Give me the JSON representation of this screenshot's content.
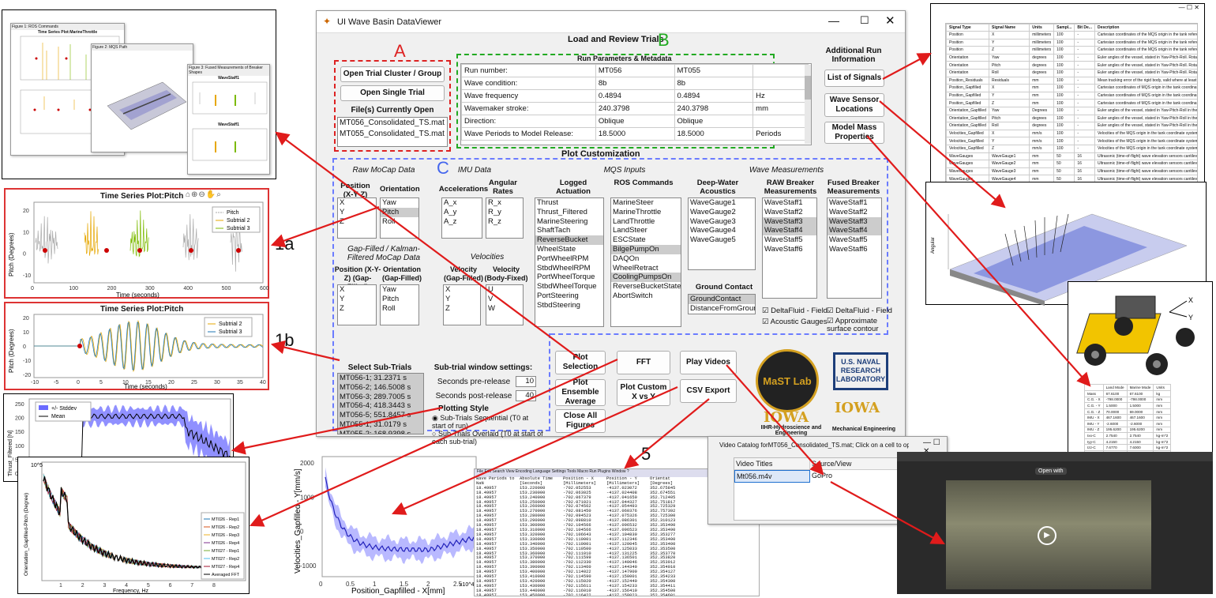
{
  "annotations": {
    "numbers": [
      "1",
      "1a",
      "1b",
      "2",
      "3",
      "4",
      "5",
      "6",
      "7",
      "8",
      "9"
    ],
    "letters": [
      "A",
      "B",
      "C"
    ]
  },
  "app": {
    "title": "UI Wave Basin DataViewer",
    "heading": "Load and Review Trials",
    "buttons": {
      "open_cluster": "Open Trial Cluster / Group",
      "open_single": "Open Single Trial",
      "list_signals": "List of Signals",
      "sensor_locations": "Wave Sensor Locations",
      "mass_properties": "Model Mass Properties",
      "plot_selection": "Plot Selection",
      "fft": "FFT",
      "play_videos": "Play Videos",
      "ensemble": "Plot Ensemble Average",
      "custom_xy": "Plot Custom X vs Y",
      "csv": "CSV Export",
      "close_figs": "Close All Figures"
    },
    "files_label": "File(s) Currently Open",
    "files": [
      "MT056_Consolidated_TS.mat",
      "MT055_Consolidated_TS.mat"
    ],
    "run_params_title": "Run Parameters & Metadata",
    "run_rows": [
      [
        "Run number:",
        "MT056",
        "MT055",
        ""
      ],
      [
        "Wave condition:",
        "8b",
        "8b",
        ""
      ],
      [
        "Wave frequency",
        "0.4894",
        "0.4894",
        "Hz"
      ],
      [
        "Wavemaker stroke:",
        "240.3798",
        "240.3798",
        "mm"
      ],
      [
        "Direction:",
        "Oblique",
        "Oblique",
        ""
      ],
      [
        "Wave Periods to Model Release:",
        "18.5000",
        "18.5000",
        "Periods"
      ]
    ],
    "additional_info": "Additional Run Information",
    "plot_customization": "Plot Customization",
    "sections": {
      "raw_mocap": "Raw MoCap Data",
      "imu": "IMU Data",
      "mqs": "MQS Inputs",
      "wave": "Wave Measurements",
      "gap": "Gap-Filled / Kalman-Filtered MoCap Data",
      "velocities": "Velocities",
      "ground": "Ground Contact",
      "select_sub": "Select Sub-Trials",
      "subwin": "Sub-trial window settings:",
      "pre": "Seconds pre-release",
      "post": "Seconds post-release",
      "plot_style": "Plotting Style",
      "seq": "Sub-Trials Sequential (T0 at start of run)",
      "overlaid": "Sub-Trials Overlaid (T0 at start of each sub-trial)"
    },
    "col_heads": {
      "position": "Position (X-Y-Z)",
      "orientation": "Orientation",
      "accel": "Accelerations",
      "angular": "Angular Rates",
      "logged": "Logged Actuation",
      "ros": "ROS Commands",
      "deep": "Deep-Water Acoustics",
      "raw_breaker": "RAW Breaker Measurements",
      "fused_breaker": "Fused Breaker Measurements",
      "pos_gap": "Position (X-Y-Z) (Gap-Filled)",
      "ori_gap": "Orientation (Gap-Filled)",
      "vel_gap": "Velocity (Gap-Filled)",
      "vel_body": "Velocity (Body-Fixed)"
    },
    "lists": {
      "position": [
        "X",
        "Y",
        "Z"
      ],
      "orientation": [
        "Yaw",
        "Pitch",
        "Roll"
      ],
      "accel": [
        "A_x",
        "A_y",
        "A_z"
      ],
      "angular": [
        "R_x",
        "R_y",
        "R_z"
      ],
      "logged": [
        "Thrust",
        "Thrust_Filtered",
        "MarineSteering",
        "ShaftTach",
        "ReverseBucket",
        "WheelState",
        "PortWheelRPM",
        "StbdWheelRPM",
        "PortWheelTorque",
        "StbdWheelTorque",
        "PortSteering",
        "StbdSteering"
      ],
      "ros": [
        "MarineSteer",
        "MarineThrottle",
        "LandThrottle",
        "LandSteer",
        "ESCState",
        "BilgePumpOn",
        "DAQOn",
        "WheelRetract",
        "CoolingPumpsOn",
        "ReverseBucketState",
        "AbortSwitch"
      ],
      "deep": [
        "WaveGauge1",
        "WaveGauge2",
        "WaveGauge3",
        "WaveGauge4",
        "WaveGauge5"
      ],
      "raw_breaker": [
        "WaveStaff1",
        "WaveStaff2",
        "WaveStaff3",
        "WaveStaff4",
        "WaveStaff5",
        "WaveStaff6"
      ],
      "fused_breaker": [
        "WaveStaff1",
        "WaveStaff2",
        "WaveStaff3",
        "WaveStaff4",
        "WaveStaff5",
        "WaveStaff6"
      ],
      "pos_gap": [
        "X",
        "Y",
        "Z"
      ],
      "ori_gap": [
        "Yaw",
        "Pitch",
        "Roll"
      ],
      "vel_gap": [
        "X",
        "Y",
        "Z"
      ],
      "vel_body": [
        "U",
        "V",
        "W"
      ],
      "ground": [
        "GroundContact",
        "DistanceFromGround"
      ],
      "subtrials": [
        "MT056-1; 31.2371 s",
        "MT056-2; 146.5008 s",
        "MT056-3; 289.7005 s",
        "MT056-4; 418.3443 s",
        "MT056-5; 551.8457 s",
        "MT055-1; 31.0179 s",
        "MT055-2; 168.9398 s",
        "MT055-3; 311.1207 s"
      ]
    },
    "checks": {
      "delta_fluid": "DeltaFluid - Field",
      "acoustic": "Acoustic Gauges",
      "delta_fluid2": "DeltaFluid - Field",
      "approx": "Approximate surface contour"
    },
    "pre_value": "10",
    "post_value": "40",
    "logo_mast": "MaST Lab",
    "logo_mast_ring": "MARINE SCIENCE AND TECHNOLOGY",
    "logo_iowa": "IOWA",
    "logo_iihr": "IIHR-Hydroscience and Engineering",
    "logo_nrl": "U.S. NAVAL RESEARCH LABORATORY",
    "logo_mech": "Mechanical Engineering"
  },
  "plot1a": {
    "title": "Time Series Plot:Pitch",
    "ylabel": "Pitch (Degrees)",
    "xlabel": "Time (seconds)",
    "legend": [
      "Pitch",
      "Subtrial 2",
      "Subtrial 3"
    ],
    "xticks": [
      "0",
      "100",
      "200",
      "300",
      "400",
      "500",
      "600"
    ],
    "yticks": [
      "20",
      "10",
      "0",
      "-10"
    ]
  },
  "plot1b": {
    "title": "Time Series Plot:Pitch",
    "ylabel": "Pitch (Degrees)",
    "xlabel": "Time (seconds)",
    "legend": [
      "Subtrial 2",
      "Subtrial 3"
    ],
    "xticks": [
      "-10",
      "-5",
      "0",
      "5",
      "10",
      "15",
      "20",
      "25",
      "30",
      "35",
      "40"
    ],
    "yticks": [
      "20",
      "10",
      "0",
      "-10",
      "-20"
    ]
  },
  "plot2": {
    "ylabel": "Thrust_Filtered [N]",
    "legend": [
      "+/- Stddev",
      "Mean"
    ],
    "yticks": [
      "250",
      "200",
      "150",
      "100",
      "50",
      "0"
    ]
  },
  "plot3": {
    "ylabel": "Orientation_Gapfilled-Pitch (Degree)",
    "xlabel": "Frequency, Hz",
    "legend": [
      "MT026 - Rep1",
      "MT026 - Rep2",
      "MT026 - Rep3",
      "MT026 - Rep4",
      "MT027 - Rep1",
      "MT027 - Rep2",
      "MT027 - Rep4",
      "Averaged FFT"
    ],
    "xticks": [
      "1",
      "2",
      "3",
      "4",
      "5",
      "6",
      "7",
      "8"
    ],
    "ytop": "10^5"
  },
  "plot4": {
    "ylabel": "Velocities_Gapfilled - Y[mm/s]",
    "xlabel": "Position_Gapfilled - X[mm]",
    "xticks": [
      "0",
      "0.5",
      "1",
      "1.5",
      "2",
      "2.5"
    ],
    "yticks": [
      "2000",
      "1000",
      "0",
      "-1000"
    ],
    "xexp": "x10^4"
  },
  "fig1": {
    "title1": "Figure 1: ROS Commands",
    "t1": "Time Series Plot:MarineThrottle",
    "t2": "Time Series Plot:LandSteer",
    "fig2title": "Figure 2: MQS Path",
    "fig3title": "Figure 3: Fused Measurements of Breaker Shapes",
    "ws1": "WaveStaff1",
    "ws2": "WaveStaff1"
  },
  "video": {
    "title": "Video Catalog forMT056_Consolidated_TS.mat; Click on a cell to open in ...",
    "col1": "Video Titles",
    "col2": "Source/View",
    "row_title": "Mt056.m4v",
    "row_src": "GoPro",
    "open_with": "Open with"
  },
  "signals": {
    "headers": [
      "Signal Type",
      "Signal Name",
      "Units",
      "Sampl...",
      "Bit De...",
      "Description"
    ],
    "rows": [
      [
        "Position",
        "X",
        "millimeters",
        "100",
        "-",
        "Cartesian coordinates of the MQS origin in the tank reference"
      ],
      [
        "Position",
        "Y",
        "millimeters",
        "100",
        "-",
        "Cartesian coordinates of the MQS origin in the tank reference"
      ],
      [
        "Position",
        "Z",
        "millimeters",
        "100",
        "-",
        "Cartesian coordinates of the MQS origin in the tank reference"
      ],
      [
        "Orientation",
        "Yaw",
        "degrees",
        "100",
        "-",
        "Euler angles of the vessel, stated in Yaw-Pitch-Roll. Rotation"
      ],
      [
        "Orientation",
        "Pitch",
        "degrees",
        "100",
        "-",
        "Euler angles of the vessel, stated in Yaw-Pitch-Roll. Rotation"
      ],
      [
        "Orientation",
        "Roll",
        "degrees",
        "100",
        "-",
        "Euler angles of the vessel, stated in Yaw-Pitch-Roll. Rotation"
      ],
      [
        "Position_Residuals",
        "Residuals",
        "mm",
        "100",
        "-",
        "Mean tracking error of the rigid body, valid where at least thre"
      ],
      [
        "Position_Gapfilled",
        "X",
        "mm",
        "100",
        "-",
        "Cartesian coordinates of MQS origin in the tank coordinate sys"
      ],
      [
        "Position_Gapfilled",
        "Y",
        "mm",
        "100",
        "-",
        "Cartesian coordinates of MQS origin in the tank coordinate sys"
      ],
      [
        "Position_Gapfilled",
        "Z",
        "mm",
        "100",
        "-",
        "Cartesian coordinates of MQS origin in the tank coordinate sys"
      ],
      [
        "Orientation_Gapfilled",
        "Yaw",
        "Degrees",
        "100",
        "-",
        "Euler angles of the vessel, stated in Yaw-Pitch-Roll in the MQS"
      ],
      [
        "Orientation_Gapfilled",
        "Pitch",
        "degrees",
        "100",
        "-",
        "Euler angles of the vessel, stated in Yaw-Pitch-Roll in the MQS"
      ],
      [
        "Orientation_Gapfilled",
        "Roll",
        "degrees",
        "100",
        "-",
        "Euler angles of the vessel, stated in Yaw-Pitch-Roll in the MQS"
      ],
      [
        "Velocities_Gapfilled",
        "X",
        "mm/s",
        "100",
        "-",
        "Velocities of the MQS origin in the tank coordinate system (Ea"
      ],
      [
        "Velocities_Gapfilled",
        "Y",
        "mm/s",
        "100",
        "-",
        "Velocities of the MQS origin in the tank coordinate system (Ea"
      ],
      [
        "Velocities_Gapfilled",
        "Z",
        "mm/s",
        "100",
        "-",
        "Velocities of the MQS origin in the tank coordinate system (Ea"
      ],
      [
        "WaveGauges",
        "WaveGauge1",
        "mm",
        "50",
        "16",
        "Ultrasonic (time-of-flight) wave elevation sensors cantilevered"
      ],
      [
        "WaveGauges",
        "WaveGauge2",
        "mm",
        "50",
        "16",
        "Ultrasonic (time-of-flight) wave elevation sensors cantilevered"
      ],
      [
        "WaveGauges",
        "WaveGauge3",
        "mm",
        "50",
        "16",
        "Ultrasonic (time-of-flight) wave elevation sensors cantilevered"
      ],
      [
        "WaveGauges",
        "WaveGauge4",
        "mm",
        "50",
        "16",
        "Ultrasonic (time-of-flight) wave elevation sensors cantilevered"
      ],
      [
        "WaveGauges",
        "WaveGauge5",
        "mm",
        "50",
        "16",
        "Ultrasonic (time-of-flight) wave elevation sensors cantilevered"
      ],
      [
        "Wavemaker",
        "WavemakerPosition",
        "mm",
        "50",
        "16",
        "Voltage proportional to motion of plunger-type wavemaker"
      ],
      [
        "Systems",
        "RelayVoltage",
        "Volts",
        "50",
        "16",
        "Status of magnetic release relay condition. High signal (> 1V"
      ],
      [
        "ROS Commands",
        "MarineSteer",
        "Counts",
        "100",
        "8",
        "Command Array Transmitted to MQS from ROS package. Det"
      ]
    ]
  },
  "mass": {
    "headers": [
      "",
      "Land Mode",
      "Marine Mode",
      "Units"
    ],
    "rows": [
      [
        "Mass",
        "67.6100",
        "67.6100",
        "kg"
      ],
      [
        "C.G. - X",
        "-798.0000",
        "-798.0000",
        "mm"
      ],
      [
        "C.G. - Y",
        "1.5000",
        "1.5000",
        "mm"
      ],
      [
        "C.G. - Z",
        "70.0000",
        "69.0000",
        "mm"
      ],
      [
        "IMU - X",
        "467.1600",
        "467.1600",
        "mm"
      ],
      [
        "IMU - Y",
        "-2.6000",
        "-2.6000",
        "mm"
      ],
      [
        "IMU - Z",
        "195.6200",
        "195.6200",
        "mm"
      ],
      [
        "Ixx-C",
        "2.7540",
        "2.7540",
        "kg-m^2"
      ],
      [
        "Iyy-C",
        "4.2150",
        "4.2150",
        "kg-m^2"
      ],
      [
        "Izz-C",
        "7.6770",
        "7.6000",
        "kg-m^2"
      ],
      [
        "Ixy-C",
        "0.0130",
        "0.0130",
        "kg-m^2"
      ],
      [
        "Ixz-C",
        "0.3380",
        "0.3380",
        "kg-m^2"
      ],
      [
        "Iyz-C",
        "0.0040",
        "0.0040",
        "kg-m^2"
      ]
    ]
  },
  "csv": {
    "headers": [
      "Wave Periods to Model release",
      "Absolute Time",
      "Position - X",
      "Position - Y",
      "Orientat"
    ],
    "units": [
      "NaN",
      "[Seconds]",
      "[Millimeters]",
      "[Millimeters]",
      "[Degrees]"
    ],
    "rows": [
      [
        "18.49957",
        "153.220000",
        "-702.052553",
        "-4137.023072",
        "352.675845"
      ],
      [
        "18.49957",
        "153.230000",
        "-702.063025",
        "-4137.024408",
        "352.674551"
      ],
      [
        "18.49957",
        "153.240000",
        "-702.067379",
        "-4137.041650",
        "352.712405"
      ],
      [
        "18.49957",
        "153.250000",
        "-702.071021",
        "-4137.044327",
        "352.751817"
      ],
      [
        "18.49957",
        "153.260000",
        "-702.074562",
        "-4137.054493",
        "352.725329"
      ],
      [
        "18.49957",
        "153.270000",
        "-702.081450",
        "-4137.060376",
        "352.757392"
      ],
      [
        "18.49957",
        "153.280000",
        "-702.094523",
        "-4137.075326",
        "352.725300"
      ],
      [
        "18.49957",
        "153.290000",
        "-702.098810",
        "-4137.086301",
        "352.310123"
      ],
      [
        "18.49957",
        "153.300000",
        "-702.104566",
        "-4137.096532",
        "352.353490"
      ],
      [
        "18.49957",
        "153.310000",
        "-702.104566",
        "-4137.096523",
        "352.353490"
      ],
      [
        "18.49957",
        "153.320000",
        "-702.106643",
        "-4137.104830",
        "352.353277"
      ],
      [
        "18.49957",
        "153.330000",
        "-702.110001",
        "-4137.112346",
        "352.353400"
      ],
      [
        "18.49957",
        "153.340000",
        "-702.110001",
        "-4137.120045",
        "352.353400"
      ],
      [
        "18.49957",
        "153.350000",
        "-702.110500",
        "-4137.125033",
        "352.353500"
      ],
      [
        "18.49957",
        "153.360000",
        "-702.111010",
        "-4137.131225",
        "352.353770"
      ],
      [
        "18.49957",
        "153.370000",
        "-702.111599",
        "-4137.136501",
        "352.353820"
      ],
      [
        "18.49957",
        "153.380000",
        "-702.112330",
        "-4137.140046",
        "352.353912"
      ],
      [
        "18.49957",
        "153.390000",
        "-702.113460",
        "-4137.144340",
        "352.354010"
      ],
      [
        "18.49957",
        "153.400000",
        "-702.114022",
        "-4137.147900",
        "352.354127"
      ],
      [
        "18.49957",
        "153.410000",
        "-702.114590",
        "-4137.150001",
        "352.354233"
      ],
      [
        "18.49957",
        "153.420000",
        "-702.115020",
        "-4137.152440",
        "352.354300"
      ],
      [
        "18.49957",
        "153.430000",
        "-702.115611",
        "-4137.154233",
        "352.354411"
      ],
      [
        "18.49957",
        "153.440000",
        "-702.116010",
        "-4137.156410",
        "352.354500"
      ],
      [
        "18.49957",
        "153.450000",
        "-702.116422",
        "-4137.158023",
        "352.354601"
      ]
    ]
  }
}
